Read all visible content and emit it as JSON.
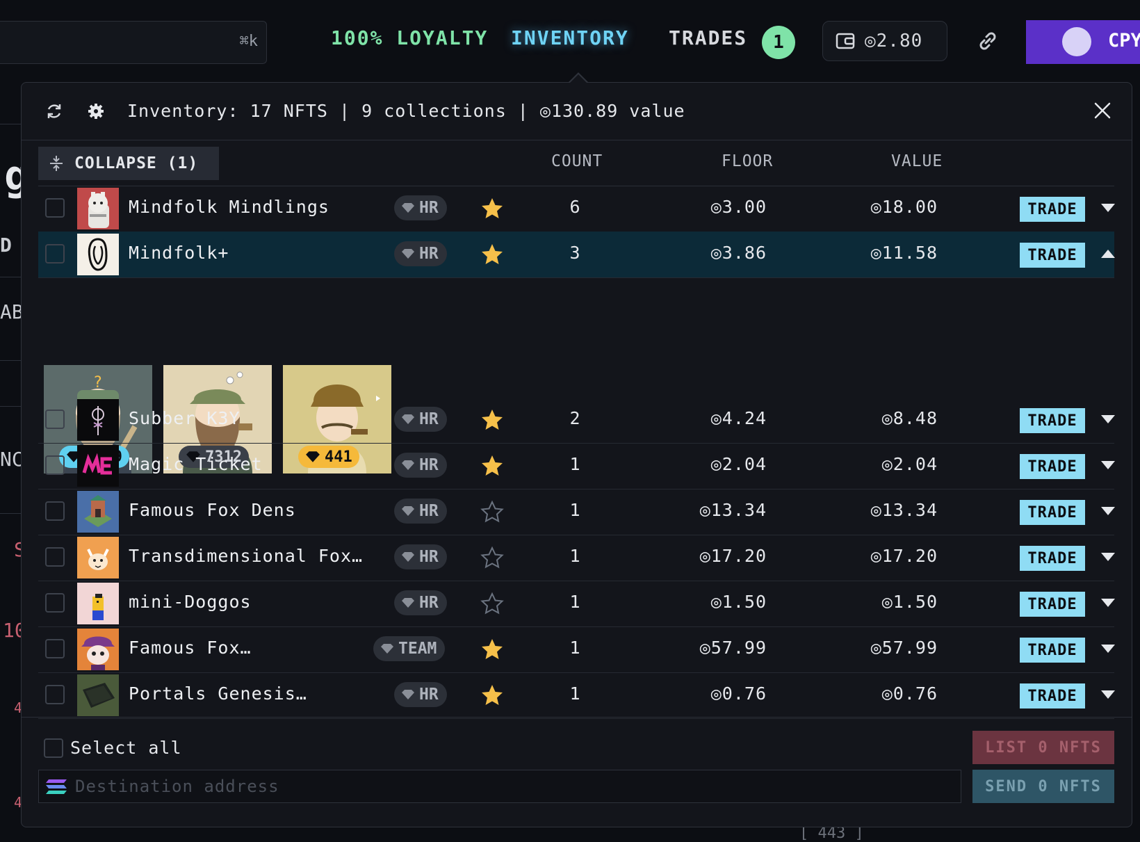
{
  "topbar": {
    "search_shortcut": "⌘k",
    "nav": {
      "loyalty": "100% LOYALTY",
      "inventory": "INVENTORY",
      "trades": "TRADES"
    },
    "trades_count": "1",
    "wallet_balance": "◎2.80",
    "user_label": "CPY"
  },
  "background": {
    "frag1": "g",
    "frag2": "D",
    "frag3": "AB",
    "frag4": "NC",
    "frag5": "S",
    "frag6": "10",
    "frag7": "4",
    "frag8": "4",
    "bottom": "[ 443 ]"
  },
  "inventory": {
    "summary": "Inventory: 17 NFTS | 9 collections | ◎130.89 value",
    "collapse_label": "COLLAPSE (1)",
    "columns": {
      "count": "COUNT",
      "floor": "FLOOR",
      "value": "VALUE"
    },
    "trade_label": "TRADE",
    "rows": [
      {
        "name": "Mindfolk Mindlings",
        "tag": "HR",
        "starred": true,
        "count": "6",
        "floor": "◎3.00",
        "value": "◎18.00"
      },
      {
        "name": "Mindfolk+",
        "tag": "HR",
        "starred": true,
        "count": "3",
        "floor": "◎3.86",
        "value": "◎11.58"
      },
      {
        "name": "Subber K3Y",
        "tag": "HR",
        "starred": true,
        "count": "2",
        "floor": "◎4.24",
        "value": "◎8.48"
      },
      {
        "name": "Magic Ticket",
        "tag": "HR",
        "starred": true,
        "count": "1",
        "floor": "◎2.04",
        "value": "◎2.04"
      },
      {
        "name": "Famous Fox Dens",
        "tag": "HR",
        "starred": false,
        "count": "1",
        "floor": "◎13.34",
        "value": "◎13.34"
      },
      {
        "name": "Transdimensional Fox…",
        "tag": "HR",
        "starred": false,
        "count": "1",
        "floor": "◎17.20",
        "value": "◎17.20"
      },
      {
        "name": "mini-Doggos",
        "tag": "HR",
        "starred": false,
        "count": "1",
        "floor": "◎1.50",
        "value": "◎1.50"
      },
      {
        "name": "Famous Fox…",
        "tag": "TEAM",
        "starred": true,
        "count": "1",
        "floor": "◎57.99",
        "value": "◎57.99"
      },
      {
        "name": "Portals Genesis…",
        "tag": "HR",
        "starred": true,
        "count": "1",
        "floor": "◎0.76",
        "value": "◎0.76"
      }
    ],
    "expanded_nfts": [
      {
        "rank": "2789",
        "pill_color": "#5fd0f0"
      },
      {
        "rank": "7312",
        "pill_color": "#3a3f48"
      },
      {
        "rank": "441",
        "pill_color": "#f5b93a"
      }
    ],
    "select_all": "Select all",
    "list_button": "LIST 0 NFTS",
    "send_button": "SEND 0 NFTS",
    "destination_placeholder": "Destination address"
  },
  "colors": {
    "accent_blue": "#8fdcf4",
    "loyalty_green": "#7fe3a8",
    "star_gold": "#f6c04a",
    "user_purple": "#5b30c8"
  }
}
